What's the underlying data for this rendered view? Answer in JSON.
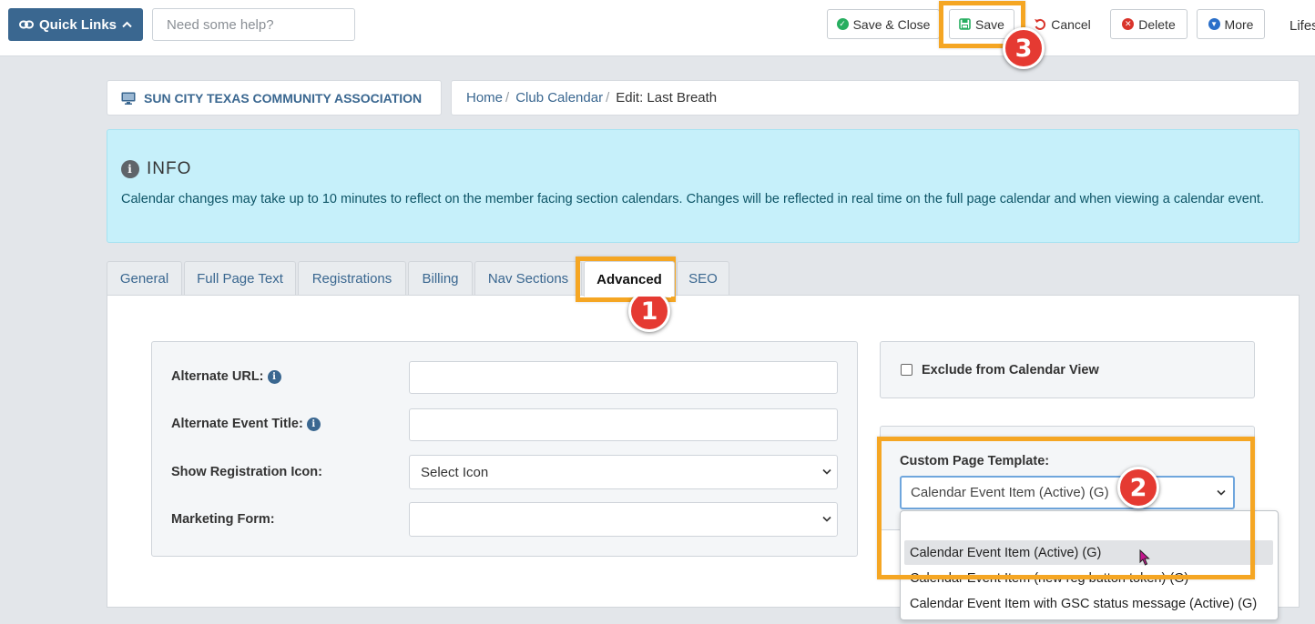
{
  "topbar": {
    "quick_links_label": "Quick Links",
    "help_placeholder": "Need some help?",
    "buttons": {
      "save_close": "Save & Close",
      "save": "Save",
      "cancel": "Cancel",
      "delete": "Delete",
      "more": "More"
    },
    "overflow_text": "Lifes"
  },
  "breadcrumb": {
    "org_name": "SUN CITY TEXAS COMMUNITY ASSOCIATION",
    "items": [
      "Home",
      "Club Calendar"
    ],
    "current": "Edit: Last Breath"
  },
  "info": {
    "heading": "INFO",
    "text": "Calendar changes may take up to 10 minutes to reflect on the member facing section calendars. Changes will be reflected in real time on the full page calendar and when viewing a calendar event."
  },
  "tabs": [
    "General",
    "Full Page Text",
    "Registrations",
    "Billing",
    "Nav Sections",
    "Advanced",
    "SEO"
  ],
  "active_tab": "Advanced",
  "form": {
    "alternate_url_label": "Alternate URL:",
    "alternate_title_label": "Alternate Event Title:",
    "show_reg_icon_label": "Show Registration Icon:",
    "show_reg_icon_value": "Select Icon",
    "marketing_form_label": "Marketing Form:",
    "marketing_form_value": ""
  },
  "exclude_label": "Exclude from Calendar View",
  "template": {
    "label": "Custom Page Template:",
    "selected": "Calendar Event Item (Active) (G)",
    "options": [
      "",
      "Calendar Event Item (Active) (G)",
      "Calendar Event Item (new reg button token) (G)",
      "Calendar Event Item with GSC status message (Active) (G)"
    ]
  },
  "annotations": [
    "1",
    "2",
    "3"
  ],
  "colors": {
    "primary": "#3a6790",
    "highlight": "#f5a623",
    "badge": "#e53a32",
    "info_bg": "#c6f0fa",
    "save_close_icon": "#27ae60",
    "save_icon": "#27ae60",
    "cancel_icon": "#d9342b",
    "delete_icon": "#d9342b",
    "more_icon": "#2a6fc9"
  }
}
